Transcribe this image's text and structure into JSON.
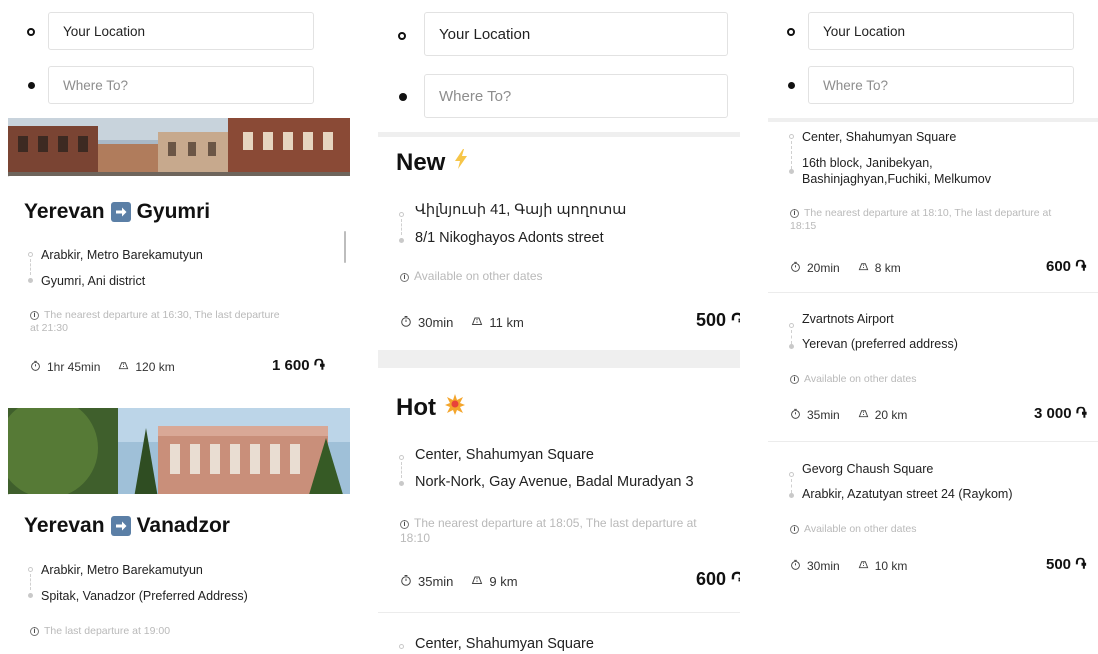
{
  "search": {
    "from_value": "Your Location",
    "to_placeholder": "Where To?"
  },
  "panel1": {
    "card1": {
      "from_city": "Yerevan",
      "to_city": "Gyumri",
      "stop_from": "Arabkir, Metro Barekamutyun",
      "stop_to": "Gyumri, Ani district",
      "note": "The nearest departure at 16:30, The last departure at 21:30",
      "duration": "1hr 45min",
      "distance": "120 km",
      "price": "1 600 ֏"
    },
    "card2": {
      "from_city": "Yerevan",
      "to_city": "Vanadzor",
      "stop_from": "Arabkir, Metro Barekamutyun",
      "stop_to": "Spitak, Vanadzor (Preferred Address)",
      "note": "The last departure at 19:00"
    }
  },
  "panel2": {
    "section_new": {
      "title": "New",
      "emoji": "⚡"
    },
    "new_card": {
      "stop_from": "Վիլնյուսի 41, Գայի պողոտա",
      "stop_to": "8/1 Nikoghayos Adonts street",
      "note": "Available on other dates",
      "duration": "30min",
      "distance": "11 km",
      "price": "500 ֏"
    },
    "section_hot": {
      "title": "Hot",
      "emoji": "💥"
    },
    "hot_card": {
      "stop_from": "Center, Shahumyan Square",
      "stop_to": "Nork-Nork, Gay Avenue, Badal Muradyan 3",
      "note": "The nearest departure at 18:05, The last departure at 18:10",
      "duration": "35min",
      "distance": "9 km",
      "price": "600 ֏"
    },
    "next_stop": "Center, Shahumyan Square"
  },
  "panel3": {
    "card1": {
      "stop_from": "Center, Shahumyan Square",
      "stop_to": "16th block, Janibekyan, Bashinjaghyan,Fuchiki, Melkumov",
      "note": "The nearest departure at 18:10, The last departure at 18:15",
      "duration": "20min",
      "distance": "8 km",
      "price": "600 ֏"
    },
    "card2": {
      "stop_from": "Zvartnots Airport",
      "stop_to": "Yerevan (preferred address)",
      "note": "Available on other dates",
      "duration": "35min",
      "distance": "20 km",
      "price": "3 000 ֏"
    },
    "card3": {
      "stop_from": "Gevorg Chaush Square",
      "stop_to": "Arabkir, Azatutyan street 24 (Raykom)",
      "note": "Available on other dates",
      "duration": "30min",
      "distance": "10 km",
      "price": "500 ֏"
    }
  },
  "colors": {
    "arrow_badge": "#5b7fa6",
    "note_gray": "#b9b9b9",
    "section_band": "#efefef"
  },
  "icons": [
    "origin-hollow-dot-icon",
    "destination-solid-dot-icon",
    "arrow-right-icon",
    "info-icon",
    "stopwatch-icon",
    "road-icon",
    "lightning-icon",
    "explosion-icon"
  ]
}
